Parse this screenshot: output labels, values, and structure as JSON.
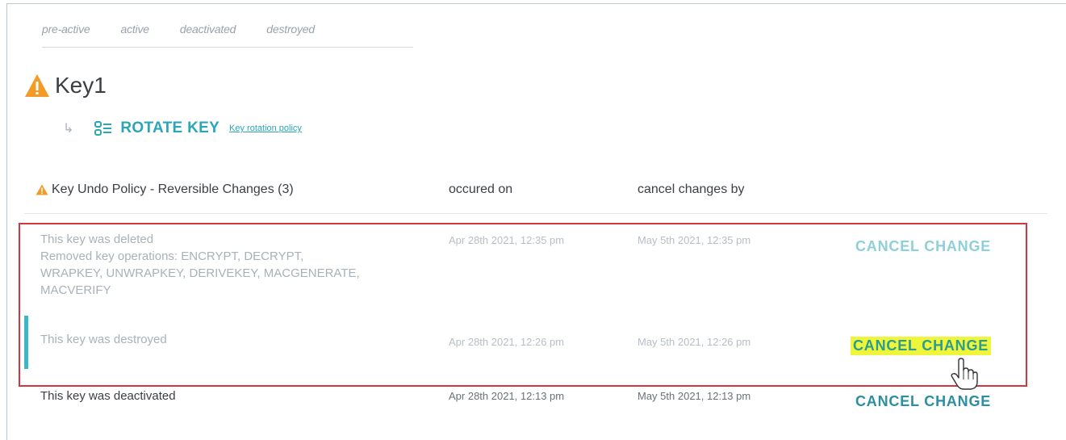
{
  "lifecycle": {
    "states": [
      "pre-active",
      "active",
      "deactivated",
      "destroyed"
    ]
  },
  "key": {
    "name": "Key1",
    "warning_icon": "warning-triangle-icon"
  },
  "rotate": {
    "label": "ROTATE KEY",
    "policy_link": "Key rotation policy"
  },
  "table": {
    "headers": {
      "policy": "Key Undo Policy - Reversible Changes (3)",
      "occurred": "occured on",
      "cancel_by": "cancel changes by"
    },
    "rows": [
      {
        "lines": [
          "This key was deleted",
          "Removed key operations: ENCRYPT, DECRYPT,",
          "WRAPKEY, UNWRAPKEY, DERIVEKEY, MACGENERATE,",
          "MACVERIFY"
        ],
        "occurred": "Apr 28th 2021, 12:35 pm",
        "cancel_by": "May 5th 2021, 12:35 pm",
        "action": "CANCEL CHANGE"
      },
      {
        "lines": [
          "This key was destroyed"
        ],
        "occurred": "Apr 28th 2021, 12:26 pm",
        "cancel_by": "May 5th 2021, 12:26 pm",
        "action": "CANCEL CHANGE"
      },
      {
        "lines": [
          "This key was deactivated"
        ],
        "occurred": "Apr 28th 2021, 12:13 pm",
        "cancel_by": "May 5th 2021, 12:13 pm",
        "action": "CANCEL CHANGE"
      }
    ]
  },
  "colors": {
    "accent": "#2aa7b7",
    "highlight": "#eef53a",
    "annotation_box": "#d2373f",
    "warning": "#f29b26"
  }
}
